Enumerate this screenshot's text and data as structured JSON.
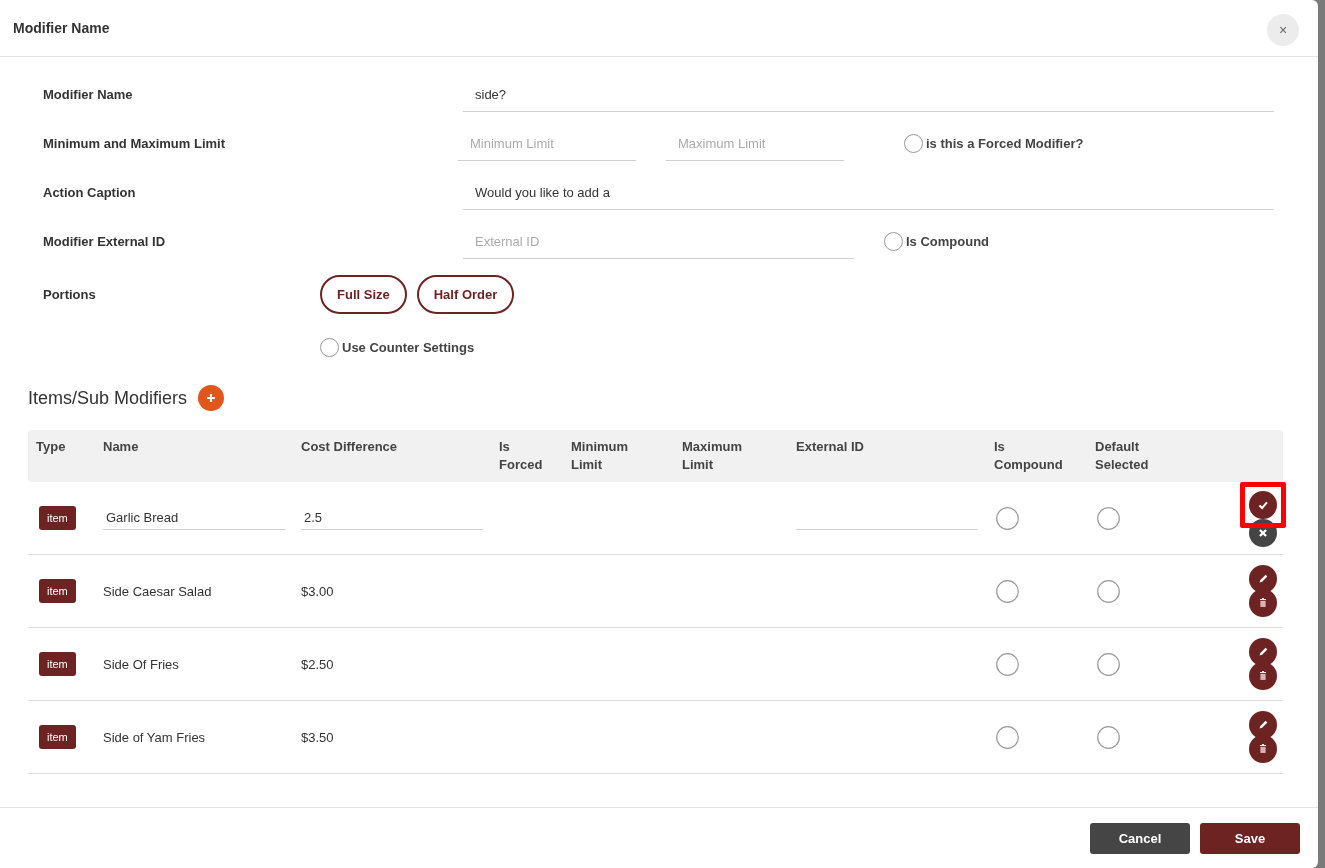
{
  "dialog": {
    "title": "Modifier Name",
    "close": "×"
  },
  "form": {
    "modifier_name": {
      "label": "Modifier Name",
      "value": "side?"
    },
    "limits": {
      "label": "Minimum and Maximum Limit",
      "min_placeholder": "Minimum Limit",
      "max_placeholder": "Maximum Limit",
      "forced": {
        "label": "is this a Forced Modifier?",
        "checked": false
      }
    },
    "action_caption": {
      "label": "Action Caption",
      "value": "Would you like to add a"
    },
    "external_id": {
      "label": "Modifier External ID",
      "placeholder": "External ID",
      "compound": {
        "label": "Is Compound",
        "checked": false
      }
    },
    "portions": {
      "label": "Portions",
      "options": [
        "Full Size",
        "Half Order"
      ]
    },
    "counter_settings": {
      "label": "Use Counter Settings",
      "checked": false
    }
  },
  "section": {
    "title": "Items/Sub Modifiers"
  },
  "table": {
    "columns": [
      "Type",
      "Name",
      "Cost Difference",
      "Is Forced",
      "Minimum Limit",
      "Maximum Limit",
      "External ID",
      "Is Compound",
      "Default Selected"
    ],
    "rows": [
      {
        "kind": "editing",
        "type": "item",
        "name": "Garlic Bread",
        "cost": "2.5",
        "is_compound": false,
        "default_selected": false,
        "highlighted": true
      },
      {
        "kind": "view",
        "type": "item",
        "name": "Side Caesar Salad",
        "cost": "$3.00",
        "is_compound": false,
        "default_selected": false,
        "highlighted": false
      },
      {
        "kind": "view",
        "type": "item",
        "name": "Side Of Fries",
        "cost": "$2.50",
        "is_compound": false,
        "default_selected": false,
        "highlighted": false
      },
      {
        "kind": "view",
        "type": "item",
        "name": "Side of Yam Fries",
        "cost": "$3.50",
        "is_compound": false,
        "default_selected": false,
        "highlighted": false
      }
    ]
  },
  "footer": {
    "cancel": "Cancel",
    "save": "Save"
  }
}
